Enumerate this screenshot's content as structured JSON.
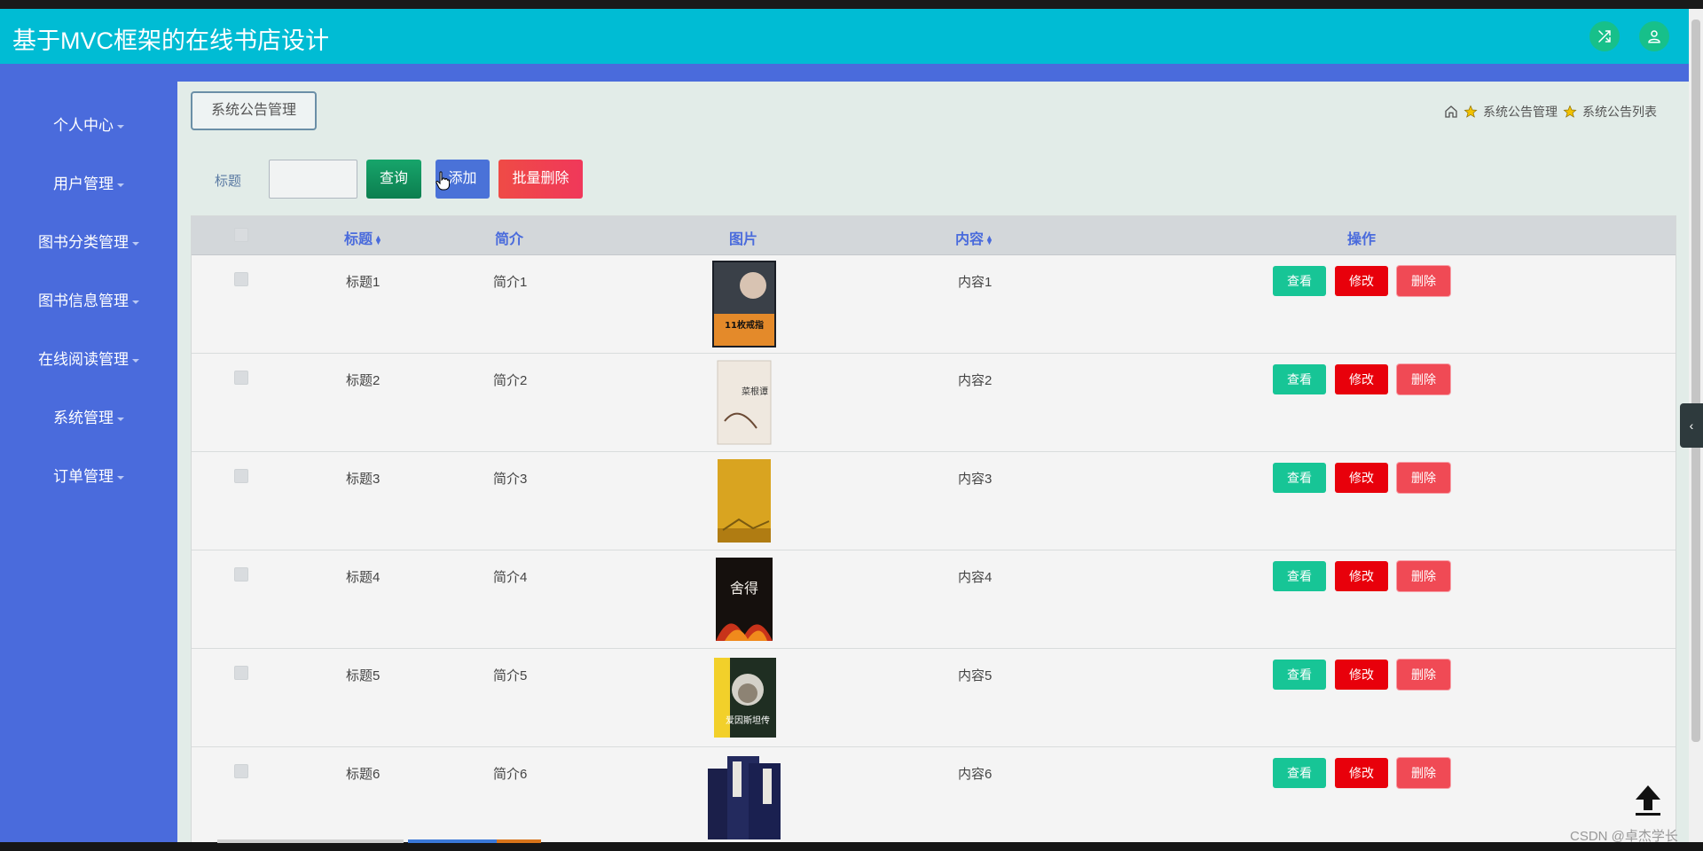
{
  "app": {
    "title": "基于MVC框架的在线书店设计"
  },
  "sidebar": {
    "items": [
      {
        "label": "个人中心"
      },
      {
        "label": "用户管理"
      },
      {
        "label": "图书分类管理"
      },
      {
        "label": "图书信息管理"
      },
      {
        "label": "在线阅读管理"
      },
      {
        "label": "系统管理"
      },
      {
        "label": "订单管理"
      }
    ]
  },
  "page": {
    "tag": "系统公告管理",
    "breadcrumb": [
      "系统公告管理",
      "系统公告列表"
    ]
  },
  "search": {
    "label": "标题",
    "value": "",
    "search_button": "查询",
    "add_button": "添加",
    "bulk_delete_button": "批量删除"
  },
  "table": {
    "columns": [
      "标题",
      "简介",
      "图片",
      "内容",
      "操作"
    ],
    "rows": [
      {
        "title": "标题1",
        "intro": "简介1",
        "content": "内容1",
        "cover_text": "11枚戒指"
      },
      {
        "title": "标题2",
        "intro": "简介2",
        "content": "内容2",
        "cover_text": "菜根谭"
      },
      {
        "title": "标题3",
        "intro": "简介3",
        "content": "内容3",
        "cover_text": ""
      },
      {
        "title": "标题4",
        "intro": "简介4",
        "content": "内容4",
        "cover_text": "舍得"
      },
      {
        "title": "标题5",
        "intro": "简介5",
        "content": "内容5",
        "cover_text": "爱因斯坦传"
      },
      {
        "title": "标题6",
        "intro": "简介6",
        "content": "内容6",
        "cover_text": ""
      }
    ],
    "actions": {
      "view": "查看",
      "edit": "修改",
      "delete": "删除"
    }
  },
  "watermark": "CSDN @卓杰学长",
  "icons": {
    "fullscreen": "shuffle-icon",
    "user": "user-icon",
    "home": "home-icon",
    "star": "star-icon",
    "back_to_top": "arrow-up-icon"
  },
  "colors": {
    "header": "#00bcd4",
    "sidebar": "#4a6bdc",
    "view": "#17c596",
    "edit": "#e8000b",
    "delete": "#f04a55"
  }
}
